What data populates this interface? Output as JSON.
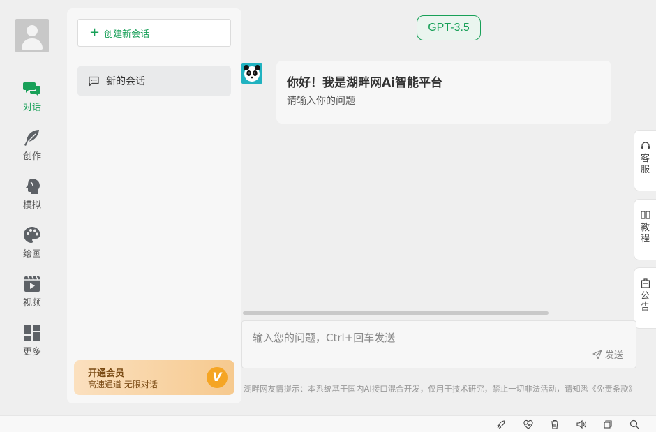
{
  "sidebar": {
    "items": [
      {
        "label": "对话",
        "icon": "chat-bubbles-icon",
        "active": true
      },
      {
        "label": "创作",
        "icon": "feather-icon",
        "active": false
      },
      {
        "label": "模拟",
        "icon": "face-profile-icon",
        "active": false
      },
      {
        "label": "绘画",
        "icon": "palette-icon",
        "active": false
      },
      {
        "label": "视频",
        "icon": "video-clapper-icon",
        "active": false
      },
      {
        "label": "更多",
        "icon": "grid-icon",
        "active": false
      }
    ]
  },
  "conversations": {
    "new_label": "创建新会话",
    "items": [
      {
        "label": "新的会话"
      }
    ]
  },
  "vip": {
    "title": "开通会员",
    "subtitle": "高速通道 无限对话",
    "badge": "V"
  },
  "model": {
    "label": "GPT-3.5"
  },
  "message": {
    "title": "你好！我是湖畔网Ai智能平台",
    "subtitle": "请输入你的问题"
  },
  "right_tabs": [
    {
      "label": "客服",
      "icon": "headset-icon"
    },
    {
      "label": "教程",
      "icon": "book-icon"
    },
    {
      "label": "公告",
      "icon": "notice-icon"
    }
  ],
  "input": {
    "placeholder": "输入您的问题，Ctrl+回车发送",
    "send_label": "发送"
  },
  "footer": {
    "note": "湖畔网友情提示：本系统基于国内AI接口混合开发，仅用于技术研究，禁止一切非法活动，请知悉《免责条款》"
  },
  "status_bar": {
    "icons": [
      "rocket-icon",
      "heartbeat-icon",
      "trash-icon",
      "speaker-icon",
      "window-icon",
      "search-icon"
    ]
  },
  "colors": {
    "accent": "#18a058",
    "vip_text": "#7a4a14",
    "vip_badge": "#f5a524"
  }
}
